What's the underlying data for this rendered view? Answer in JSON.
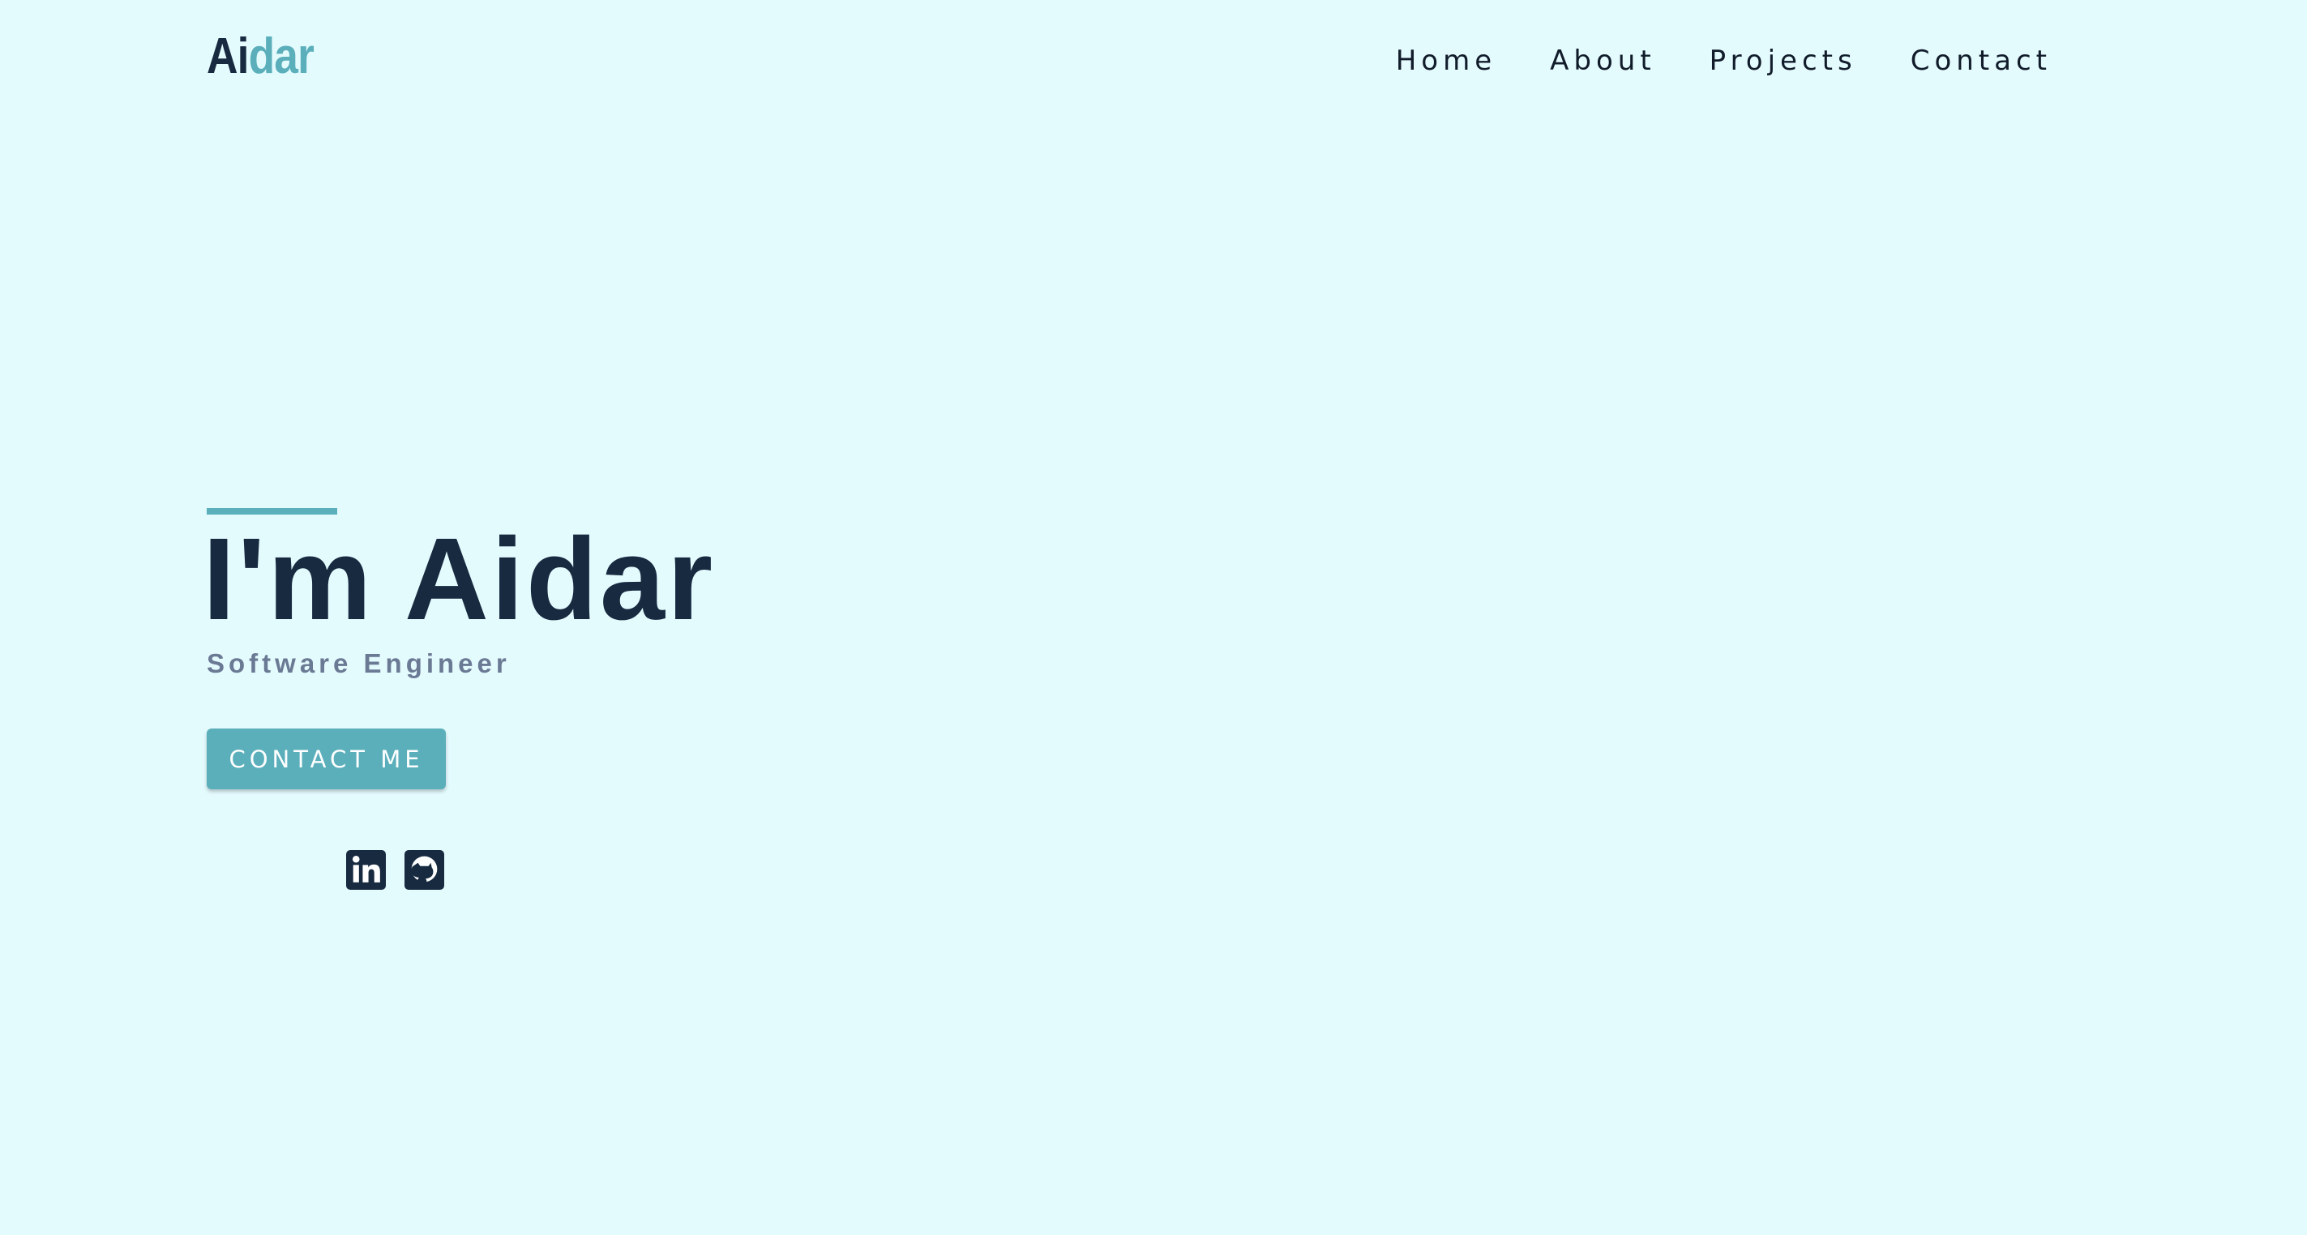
{
  "header": {
    "logo_part1": "Ai",
    "logo_part2": "dar",
    "nav": [
      {
        "label": "Home"
      },
      {
        "label": "About"
      },
      {
        "label": "Projects"
      },
      {
        "label": "Contact"
      }
    ]
  },
  "hero": {
    "title": "I'm Aidar",
    "subtitle": "Software Engineer",
    "cta_label": "CONTACT ME"
  },
  "social": [
    {
      "icon": "linkedin-icon"
    },
    {
      "icon": "github-icon"
    }
  ],
  "colors": {
    "background": "#e4fbfe",
    "accent": "#5aafbb",
    "dark": "#172a40",
    "muted": "#6b7a94"
  }
}
